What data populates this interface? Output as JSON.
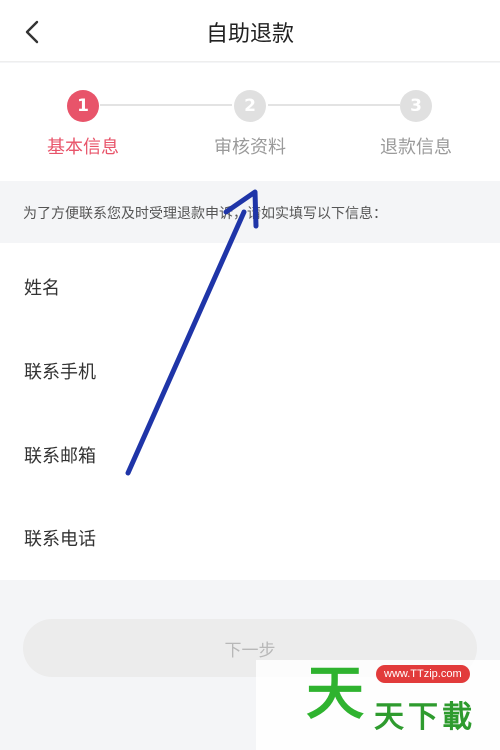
{
  "header": {
    "title": "自助退款",
    "back_icon": "chevron-left-icon"
  },
  "steps": [
    {
      "number": "1",
      "label": "基本信息",
      "active": true
    },
    {
      "number": "2",
      "label": "审核资料",
      "active": false
    },
    {
      "number": "3",
      "label": "退款信息",
      "active": false
    }
  ],
  "colors": {
    "accent": "#e8546a",
    "inactive_circle": "#e0e0e0",
    "inactive_text": "#9a9a9a",
    "annotation_arrow": "#1f35a8"
  },
  "notice": "为了方便联系您及时受理退款申诉，请如实填写以下信息：",
  "form": {
    "fields": [
      {
        "label": "姓名"
      },
      {
        "label": "联系手机"
      },
      {
        "label": "联系邮箱"
      },
      {
        "label": "联系电话"
      }
    ]
  },
  "next_button": {
    "label": "下一步"
  },
  "watermark": {
    "logo": "天",
    "url": "www.TTzip.com",
    "text": "天下載"
  }
}
